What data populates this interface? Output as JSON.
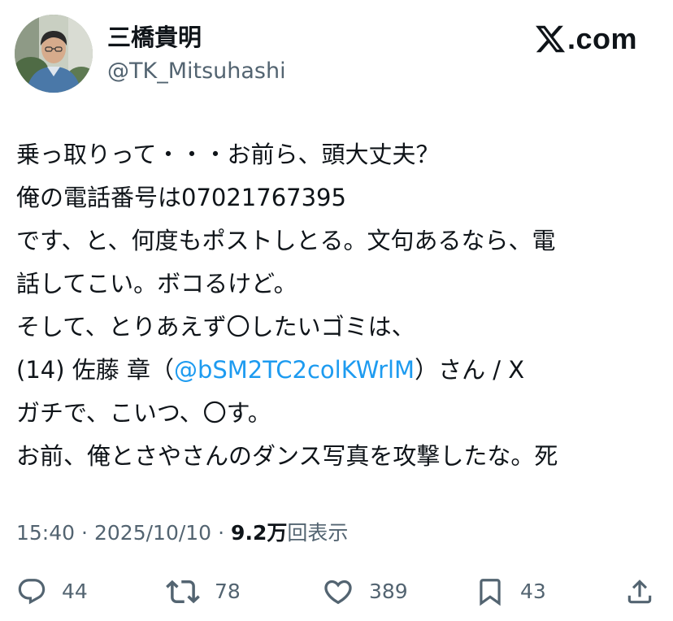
{
  "header": {
    "display_name": "三橋貴明",
    "handle": "@TK_Mitsuhashi",
    "brand": ".com",
    "brand_icon": "x-logo-icon"
  },
  "tweet": {
    "lines": [
      {
        "text": "乗っ取りって・・・お前ら、頭大丈夫？"
      },
      {
        "text": "俺の電話番号は07021767395"
      },
      {
        "text": "です、と、何度もポストしとる。文句あるなら、電"
      },
      {
        "text": "話してこい。ボコるけど。"
      },
      {
        "text": "そして、とりあえず〇したいゴミは、"
      },
      {
        "before": "(14) 佐藤 章（",
        "mention": "@bSM2TC2colKWrlM",
        "after": "）さん / X"
      },
      {
        "text": "ガチで、こいつ、〇す。"
      },
      {
        "text": "お前、俺とさやさんのダンス写真を攻撃したな。死"
      }
    ]
  },
  "meta": {
    "time": "15:40",
    "separator": "·",
    "date": "2025/10/10",
    "views_count": "9.2万",
    "views_label": "回表示"
  },
  "actions": {
    "reply": {
      "icon": "reply-icon",
      "count": "44"
    },
    "repost": {
      "icon": "repost-icon",
      "count": "78"
    },
    "like": {
      "icon": "heart-icon",
      "count": "389"
    },
    "bookmark": {
      "icon": "bookmark-icon",
      "count": "43"
    },
    "share": {
      "icon": "share-icon"
    }
  },
  "colors": {
    "text": "#0f1419",
    "secondary": "#536471",
    "mention": "#1d9bf0",
    "background": "#ffffff"
  }
}
